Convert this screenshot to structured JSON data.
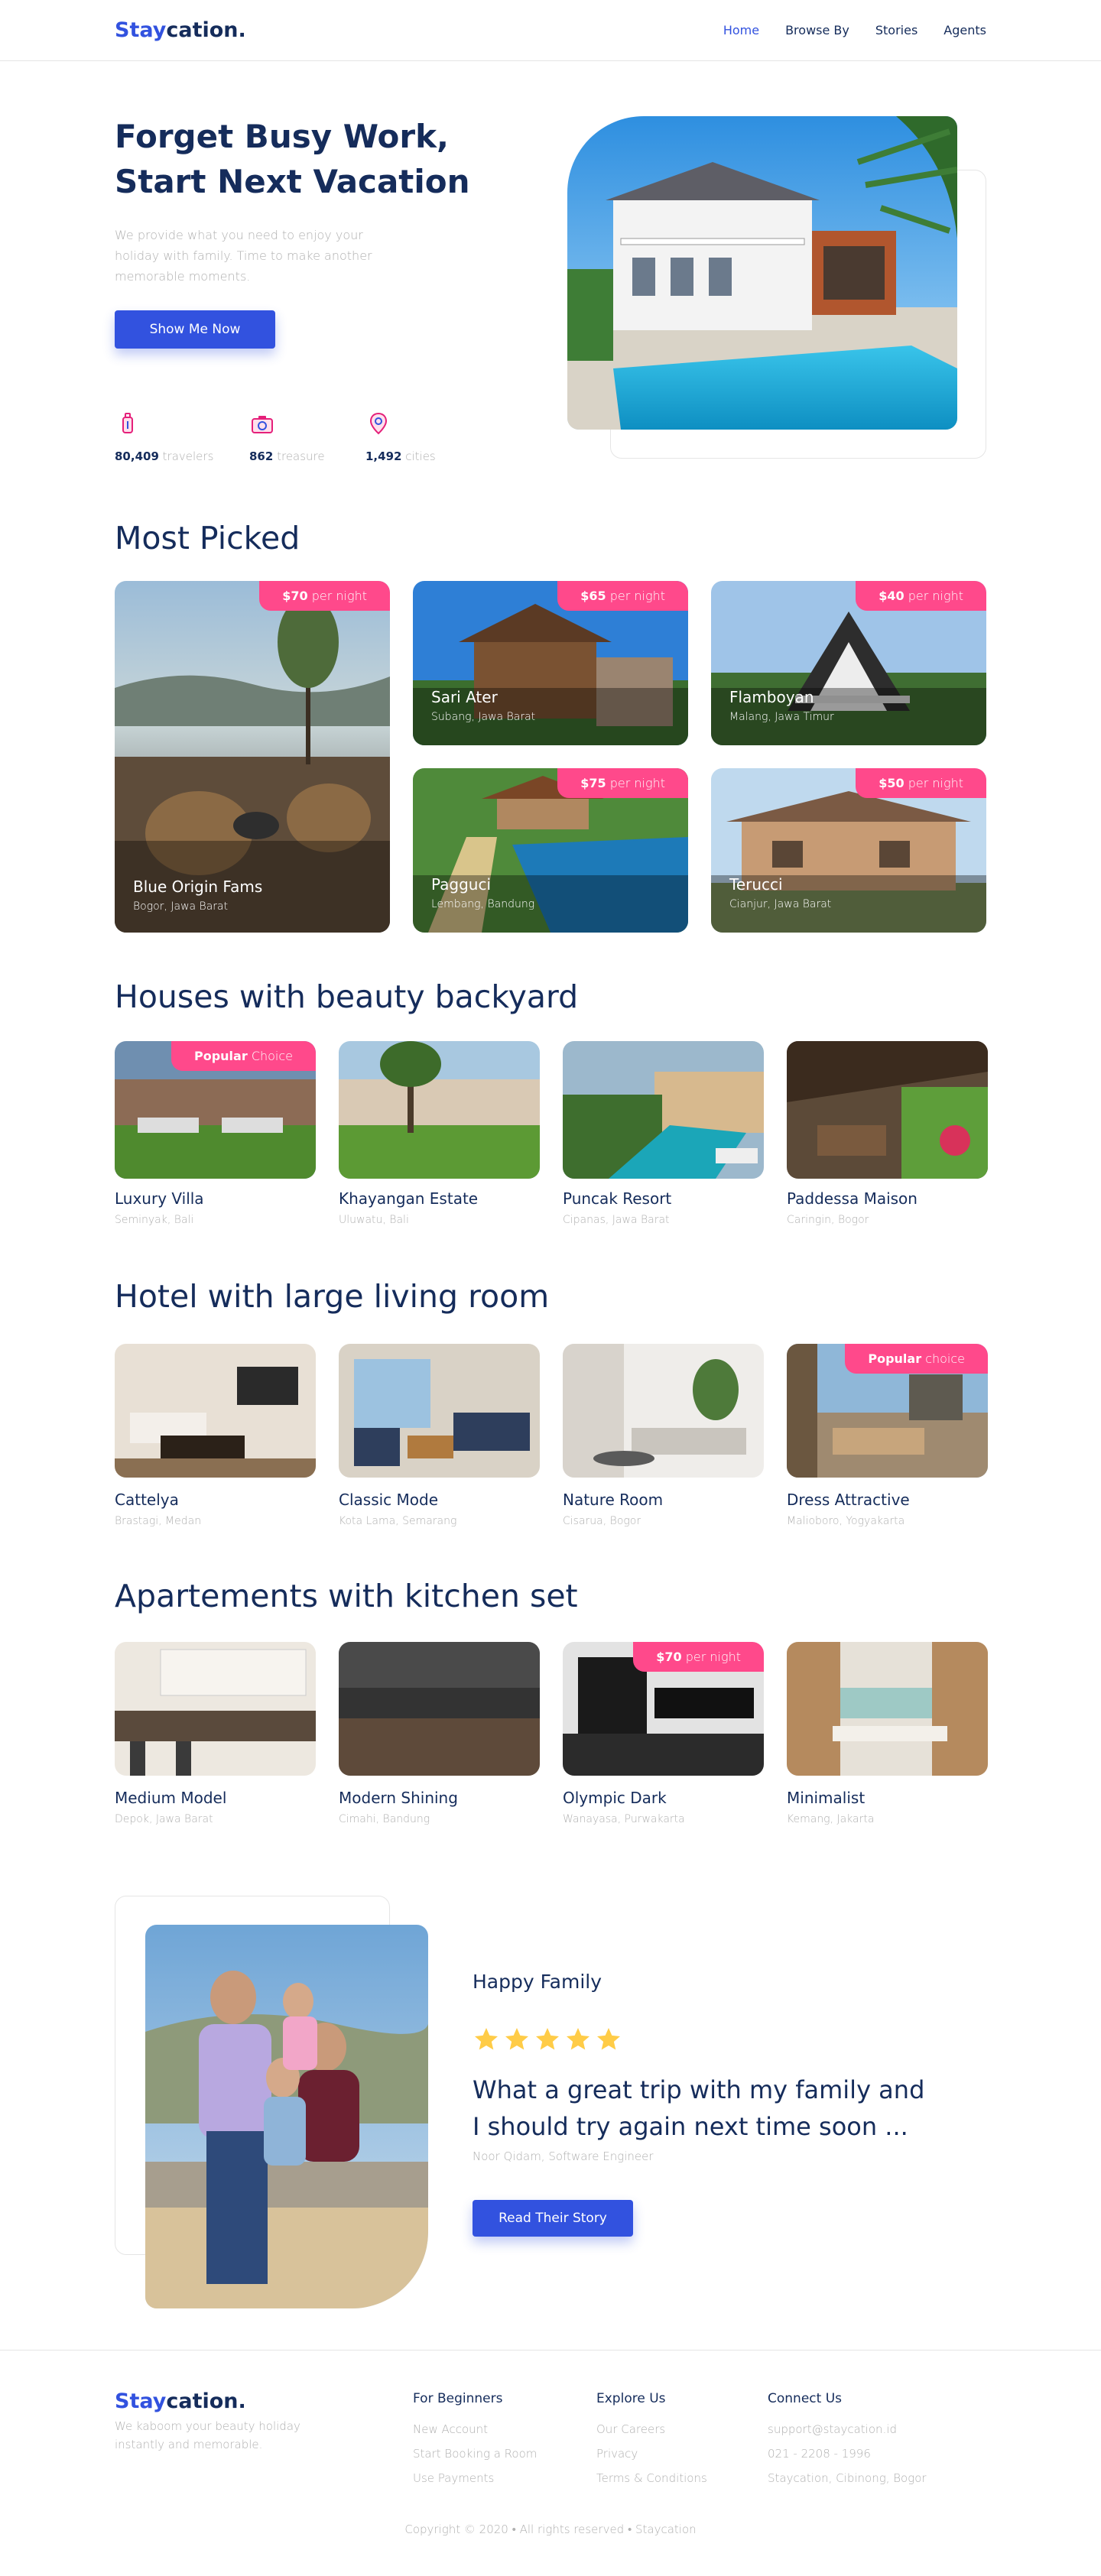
{
  "header": {
    "logo_part1": "Stay",
    "logo_part2": "cation.",
    "nav": [
      "Home",
      "Browse By",
      "Stories",
      "Agents"
    ]
  },
  "hero": {
    "title_line1": "Forget Busy Work,",
    "title_line2": "Start Next Vacation",
    "description": "We provide what you need to enjoy your holiday with family. Time to make another memorable moments.",
    "button": "Show Me Now",
    "stats": [
      {
        "value": "80,409",
        "unit": "travelers",
        "icon": "traveler-icon"
      },
      {
        "value": "862",
        "unit": "treasure",
        "icon": "camera-icon"
      },
      {
        "value": "1,492",
        "unit": "cities",
        "icon": "map-pin-icon"
      }
    ]
  },
  "most_picked": {
    "title": "Most Picked",
    "per_night": "per night",
    "items": [
      {
        "price": "$70",
        "name": "Blue Origin Fams",
        "location": "Bogor, Jawa Barat"
      },
      {
        "price": "$65",
        "name": "Sari Ater",
        "location": "Subang, Jawa Barat"
      },
      {
        "price": "$40",
        "name": "Flamboyan",
        "location": "Malang, Jawa Timur"
      },
      {
        "price": "$75",
        "name": "Pagguci",
        "location": "Lembang, Bandung"
      },
      {
        "price": "$50",
        "name": "Terucci",
        "location": "Cianjur, Jawa Barat"
      }
    ]
  },
  "backyard": {
    "title": "Houses with beauty backyard",
    "badge_bold": "Popular",
    "badge_light": "Choice",
    "items": [
      {
        "name": "Luxury Villa",
        "location": "Seminyak, Bali"
      },
      {
        "name": "Khayangan Estate",
        "location": "Uluwatu, Bali"
      },
      {
        "name": "Puncak Resort",
        "location": "Cipanas, Jawa Barat"
      },
      {
        "name": "Paddessa Maison",
        "location": "Caringin, Bogor"
      }
    ]
  },
  "living": {
    "title": "Hotel with large living room",
    "badge_bold": "Popular",
    "badge_light": "choice",
    "items": [
      {
        "name": "Cattelya",
        "location": "Brastagi, Medan"
      },
      {
        "name": "Classic Mode",
        "location": "Kota Lama, Semarang"
      },
      {
        "name": "Nature Room",
        "location": "Cisarua, Bogor"
      },
      {
        "name": "Dress Attractive",
        "location": "Malioboro, Yogyakarta"
      }
    ]
  },
  "kitchen": {
    "title": "Apartements with kitchen set",
    "badge_price": "$70",
    "badge_light": "per night",
    "items": [
      {
        "name": "Medium Model",
        "location": "Depok, Jawa Barat"
      },
      {
        "name": "Modern Shining",
        "location": "Cimahi, Bandung"
      },
      {
        "name": "Olympic Dark",
        "location": "Wanayasa, Purwakarta"
      },
      {
        "name": "Minimalist",
        "location": "Kemang, Jakarta"
      }
    ]
  },
  "testimonial": {
    "heading": "Happy Family",
    "rating": 5,
    "quote": "What a great trip with my family and I should try again next time soon ...",
    "author": "Noor Qidam, Software Engineer",
    "button": "Read Their Story"
  },
  "footer": {
    "logo_part1": "Stay",
    "logo_part2": "cation.",
    "description": "We kaboom your beauty holiday instantly and memorable.",
    "col1_title": "For Beginners",
    "col1": [
      "New Account",
      "Start Booking a Room",
      "Use Payments"
    ],
    "col2_title": "Explore Us",
    "col2": [
      "Our Careers",
      "Privacy",
      "Terms & Conditions"
    ],
    "col3_title": "Connect Us",
    "col3": [
      "support@staycation.id",
      "021 - 2208 - 1996",
      "Staycation, Cibinong, Bogor"
    ],
    "copyright": "Copyright © 2020 • All rights reserved • Staycation"
  },
  "colors": {
    "primary": "#3252DF",
    "navy": "#152C5B",
    "pink": "#FF498B",
    "gray": "#B0B0B0",
    "star": "#FFCC47"
  }
}
